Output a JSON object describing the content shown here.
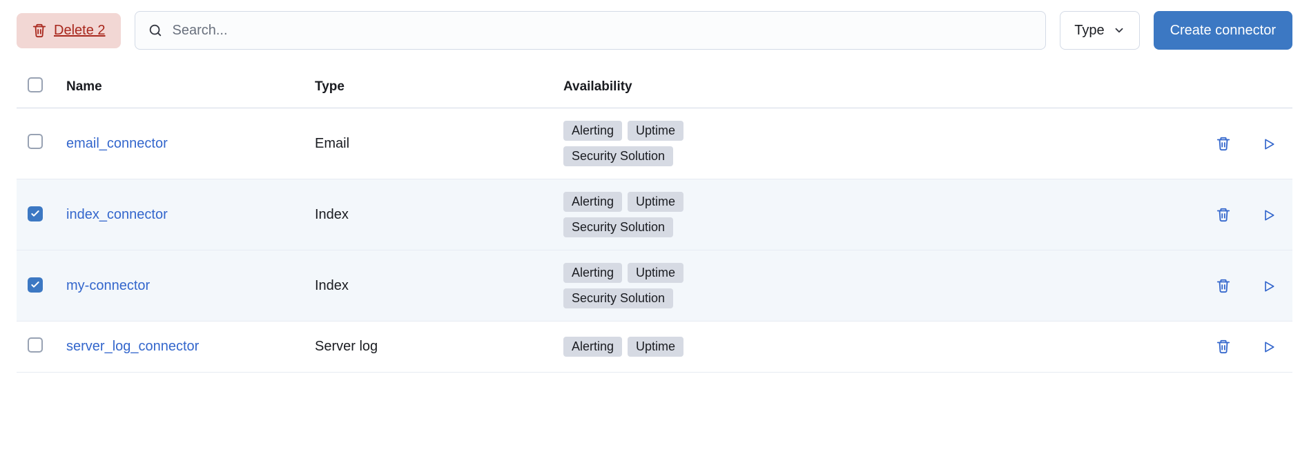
{
  "toolbar": {
    "delete_label": "Delete 2",
    "search_placeholder": "Search...",
    "type_filter_label": "Type",
    "create_label": "Create connector"
  },
  "table": {
    "headers": {
      "name": "Name",
      "type": "Type",
      "availability": "Availability"
    },
    "rows": [
      {
        "checked": false,
        "name": "email_connector",
        "type": "Email",
        "badges": [
          "Alerting",
          "Uptime",
          "Security Solution"
        ]
      },
      {
        "checked": true,
        "name": "index_connector",
        "type": "Index",
        "badges": [
          "Alerting",
          "Uptime",
          "Security Solution"
        ]
      },
      {
        "checked": true,
        "name": "my-connector",
        "type": "Index",
        "badges": [
          "Alerting",
          "Uptime",
          "Security Solution"
        ]
      },
      {
        "checked": false,
        "name": "server_log_connector",
        "type": "Server log",
        "badges": [
          "Alerting",
          "Uptime"
        ]
      }
    ]
  }
}
